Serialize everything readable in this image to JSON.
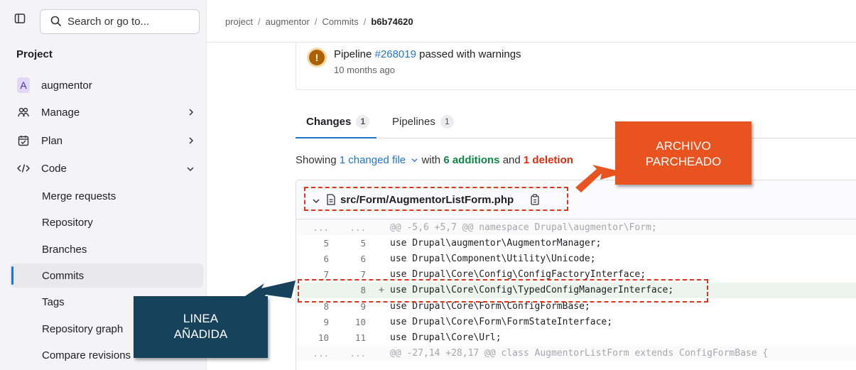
{
  "sidebar": {
    "search_label": "Search or go to...",
    "section_title": "Project",
    "items": [
      {
        "label": "augmentor",
        "avatar": "A"
      },
      {
        "label": "Manage",
        "icon": "users-icon"
      },
      {
        "label": "Plan",
        "icon": "calendar-icon"
      },
      {
        "label": "Code",
        "icon": "code-icon"
      },
      {
        "label": "Merge requests"
      },
      {
        "label": "Repository"
      },
      {
        "label": "Branches"
      },
      {
        "label": "Commits"
      },
      {
        "label": "Tags"
      },
      {
        "label": "Repository graph"
      },
      {
        "label": "Compare revisions"
      }
    ]
  },
  "breadcrumb": {
    "items": [
      "project",
      "augmentor",
      "Commits"
    ],
    "current": "b6b74620"
  },
  "pipeline": {
    "prefix": "Pipeline",
    "id": "#268019",
    "status": "passed with warnings",
    "time": "10 months ago",
    "icon": "warning-icon"
  },
  "tabs": [
    {
      "label": "Changes",
      "count": "1"
    },
    {
      "label": "Pipelines",
      "count": "1"
    }
  ],
  "summary": {
    "showing": "Showing",
    "changed": "1 changed file",
    "with": "with",
    "additions": "6 additions",
    "and": "and",
    "deletions": "1 deletion"
  },
  "file": {
    "name": "src/Form/AugmentorListForm.php",
    "lines": [
      {
        "old": "...",
        "new": "...",
        "text": "@@ -5,6 +5,7 @@ namespace Drupal\\augmentor\\Form;"
      },
      {
        "old": "5",
        "new": "5",
        "text": "use Drupal\\augmentor\\AugmentorManager;"
      },
      {
        "old": "6",
        "new": "6",
        "text": "use Drupal\\Component\\Utility\\Unicode;"
      },
      {
        "old": "7",
        "new": "7",
        "text": "use Drupal\\Core\\Config\\ConfigFactoryInterface;"
      },
      {
        "old": "",
        "new": "8",
        "marker": "+",
        "text": "use Drupal\\Core\\Config\\TypedConfigManagerInterface;"
      },
      {
        "old": "8",
        "new": "9",
        "text": "use Drupal\\Core\\Form\\ConfigFormBase;"
      },
      {
        "old": "9",
        "new": "10",
        "text": "use Drupal\\Core\\Form\\FormStateInterface;"
      },
      {
        "old": "10",
        "new": "11",
        "text": "use Drupal\\Core\\Url;"
      },
      {
        "old": "...",
        "new": "...",
        "text": "@@ -27,14 +28,17 @@ class AugmentorListForm extends ConfigFormBase {"
      }
    ]
  },
  "annotations": {
    "patched_file": [
      "ARCHIVO",
      "PARCHEADO"
    ],
    "added_line": [
      "LINEA",
      "AÑADIDA"
    ],
    "orange": "#e8531f",
    "navy": "#17425c"
  }
}
